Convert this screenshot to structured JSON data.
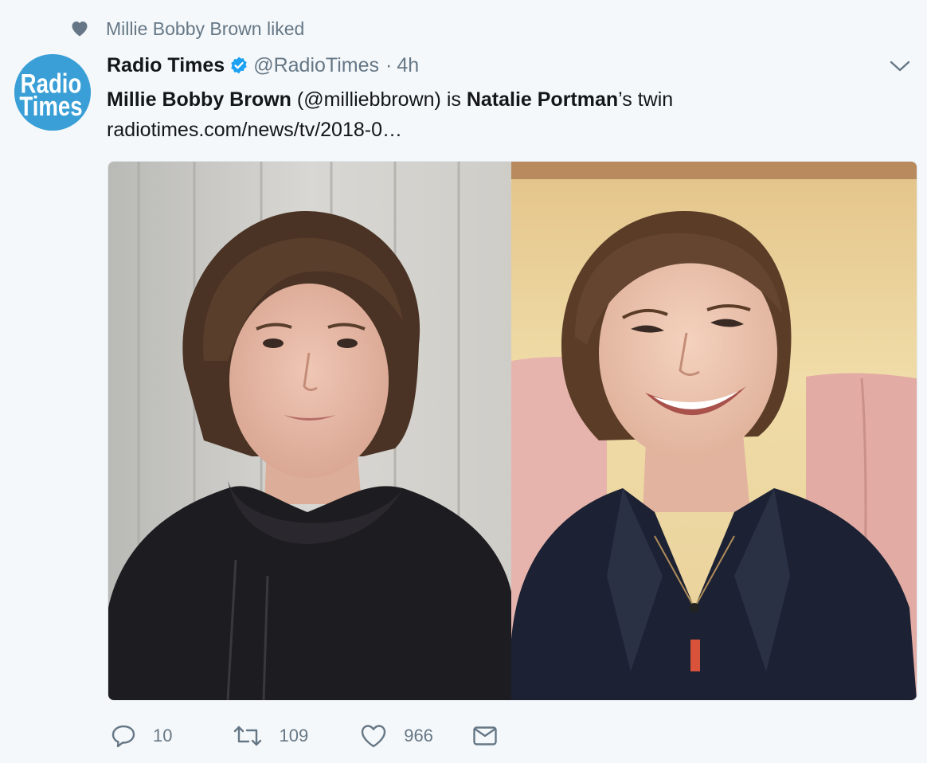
{
  "context": {
    "icon": "heart-icon",
    "label": "Millie Bobby Brown liked"
  },
  "author": {
    "avatar_label_line1": "Radio",
    "avatar_label_line2": "Times",
    "avatar_color": "#3a9fd6",
    "name": "Radio Times",
    "verified": true,
    "handle": "@RadioTimes",
    "separator": "·",
    "time": "4h"
  },
  "tweet": {
    "part1": "Millie Bobby Brown",
    "part2": " (@milliebbrown) is ",
    "part3": "Natalie Portman",
    "part4": "’s twin",
    "link": "radiotimes.com/news/tv/2018-0…"
  },
  "actions": {
    "reply_count": "10",
    "retweet_count": "109",
    "like_count": "966"
  },
  "colors": {
    "background": "#f5f8fa",
    "secondary_text": "#657786",
    "primary_text": "#14171a",
    "verified_blue": "#1da1f2"
  }
}
